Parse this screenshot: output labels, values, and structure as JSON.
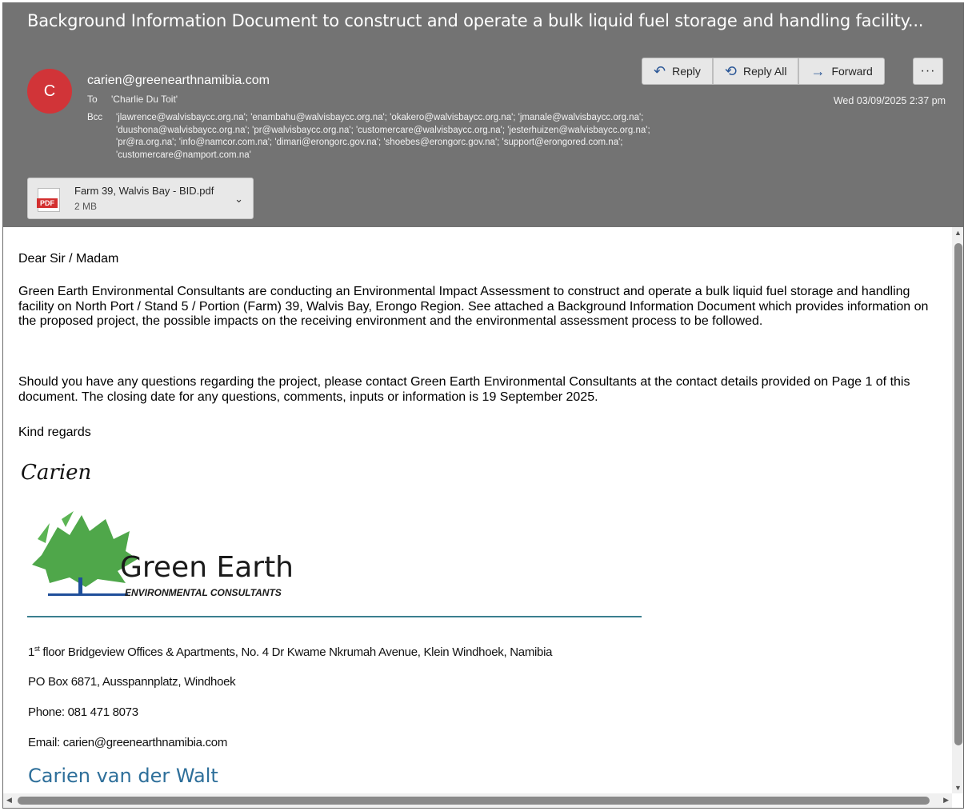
{
  "email": {
    "subject": "Background Information Document to construct and operate a bulk liquid fuel storage and handling facility...",
    "avatar_initial": "C",
    "from": "carien@greenearthnamibia.com",
    "to_label": "To",
    "to": "'Charlie Du Toit'",
    "bcc_label": "Bcc",
    "bcc_lines": [
      "'jlawrence@walvisbaycc.org.na'; 'enambahu@walvisbaycc.org.na'; 'okakero@walvisbaycc.org.na'; 'jmanale@walvisbaycc.org.na';",
      "'duushona@walvisbaycc.org.na'; 'pr@walvisbaycc.org.na'; 'customercare@walvisbaycc.org.na'; 'jesterhuizen@walvisbaycc.org.na';",
      "'pr@ra.org.na'; 'info@namcor.com.na'; 'dimari@erongorc.gov.na'; 'shoebes@erongorc.gov.na'; 'support@erongored.com.na';",
      "'customercare@namport.com.na'"
    ],
    "date": "Wed 03/09/2025 2:37 pm"
  },
  "actions": {
    "reply": "Reply",
    "reply_all": "Reply All",
    "forward": "Forward",
    "more": "···"
  },
  "attachment": {
    "icon_label": "PDF",
    "name": "Farm 39, Walvis Bay - BID.pdf",
    "size": "2 MB"
  },
  "body": {
    "greeting": "Dear Sir / Madam",
    "para1": "Green Earth Environmental Consultants are conducting an Environmental Impact Assessment to construct and operate a bulk liquid fuel storage and handling facility on North Port / Stand 5 / Portion (Farm) 39, Walvis Bay, Erongo Region.  See attached a Background Information Document which provides information on the proposed project, the possible impacts on the receiving environment and the environmental assessment process to be followed.",
    "para2": "Should you have any questions regarding the project, please contact Green Earth Environmental Consultants at the contact details provided on Page 1 of this document.  The closing date for any questions, comments, inputs or information is 19 September 2025.",
    "closing": "Kind regards",
    "signature": "Carien"
  },
  "logo": {
    "title": "Green Earth",
    "subtitle": "ENVIRONMENTAL CONSULTANTS"
  },
  "contact": {
    "address_prefix": "1",
    "address_sup": "st",
    "address_rest": " floor Bridgeview Offices & Apartments, No. 4 Dr Kwame Nkrumah Avenue, Klein Windhoek, Namibia",
    "po_box": "PO Box 6871, Ausspannplatz, Windhoek",
    "phone": "Phone: 081 471 8073",
    "email": "Email: carien@greenearthnamibia.com",
    "name": "Carien van der Walt"
  },
  "colors": {
    "header_bg": "#737373",
    "avatar": "#d13438",
    "accent": "#2b5797",
    "rule": "#3a7f8f",
    "tree_green": "#4fa74a"
  }
}
